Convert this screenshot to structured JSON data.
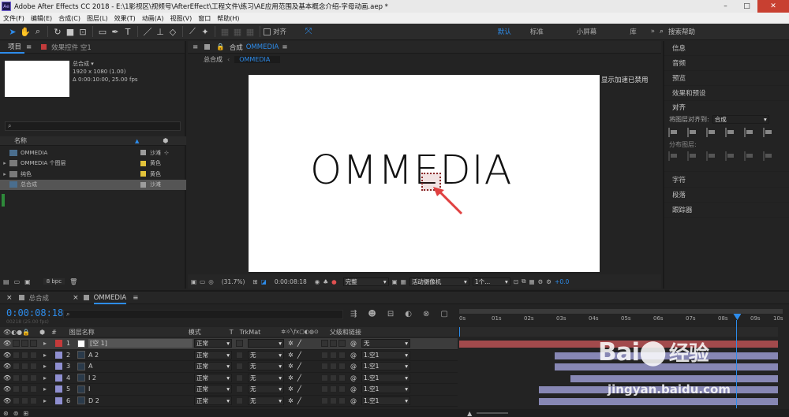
{
  "titlebar": {
    "app_icon": "Ae",
    "title": "Adobe After Effects CC 2018 - E:\\1影视区\\视频号\\AfterEffect\\工程文件\\练习\\AE应用范围及基本概念介绍-字母动画.aep *",
    "min": "–",
    "max": "□",
    "close": "✕"
  },
  "menu": [
    "文件(F)",
    "编辑(E)",
    "合成(C)",
    "图层(L)",
    "效果(T)",
    "动画(A)",
    "视图(V)",
    "窗口",
    "帮助(H)"
  ],
  "toolbar": {
    "snap_label": "对齐",
    "workspaces": [
      "默认",
      "标准",
      "小屏幕",
      "库"
    ],
    "more": "»",
    "search_placeholder": "搜索帮助"
  },
  "project": {
    "tab_project": "项目",
    "tab_effects": "效果控件 空1",
    "thumb_name": "总合成 ▾",
    "thumb_res": "1920 x 1080 (1.00)",
    "thumb_dur": "Δ 0:00:10:00, 25.00 fps",
    "col_name": "名称",
    "col_label": "标签",
    "items": [
      {
        "name": "OMMEDIA",
        "tag": "沙滩",
        "color": "#9c9c9c",
        "type": "comp"
      },
      {
        "name": "OMMEDIA 个图层",
        "tag": "黄色",
        "color": "#e2c23a",
        "type": "folder"
      },
      {
        "name": "纯色",
        "tag": "黄色",
        "color": "#e2c23a",
        "type": "folder"
      },
      {
        "name": "总合成",
        "tag": "沙滩",
        "color": "#9c9c9c",
        "type": "comp",
        "selected": true
      }
    ],
    "bpc": "8 bpc"
  },
  "composition": {
    "tab": "合成",
    "comp_link": "OMMEDIA",
    "breadcrumb_root": "总合成",
    "breadcrumb_child": "OMMEDIA",
    "canvas_text": "OMMEDIA",
    "gpu_note": "显示加速已禁用",
    "zoom": "(31.7%)",
    "timecode": "0:00:08:18",
    "resolution": "完整",
    "camera": "活动摄像机",
    "views": "1个...",
    "exposure": "+0.0"
  },
  "right_panel": {
    "items_top": [
      "信息",
      "音频",
      "预览",
      "效果和预设"
    ],
    "align_title": "对齐",
    "align_to_label": "将图层对齐到:",
    "align_to_value": "合成",
    "distribute_label": "分布图层:",
    "items_bottom": [
      "字符",
      "段落",
      "跟踪器"
    ]
  },
  "timeline": {
    "tab1": "总合成",
    "tab2": "OMMEDIA",
    "timecode": "0:00:08:18",
    "frames": "00218 (25.00 fps)",
    "col_layer": "图层名称",
    "col_mode": "模式",
    "col_t": "T",
    "col_trkmat": "TrkMat",
    "col_parent": "父级和链接",
    "ruler": [
      "0s",
      "01s",
      "02s",
      "03s",
      "04s",
      "05s",
      "06s",
      "07s",
      "08s",
      "09s",
      "10s"
    ],
    "playhead_frac": 0.87,
    "layers": [
      {
        "num": "1",
        "name": "[空 1]",
        "mode": "正常",
        "trk": "",
        "parent": "无",
        "color": "#c43a3a",
        "bar_start": 0.0,
        "bar_end": 1.0,
        "bar_color": "#a24a4c",
        "selected": true
      },
      {
        "num": "2",
        "name": "A 2",
        "mode": "正常",
        "trk": "无",
        "parent": "1.空1",
        "color": "#8f8fd0",
        "bar_start": 0.3,
        "bar_end": 1.0,
        "bar_color": "#8787b4"
      },
      {
        "num": "3",
        "name": "A",
        "mode": "正常",
        "trk": "无",
        "parent": "1.空1",
        "color": "#8f8fd0",
        "bar_start": 0.3,
        "bar_end": 1.0,
        "bar_color": "#8787b4"
      },
      {
        "num": "4",
        "name": "I 2",
        "mode": "正常",
        "trk": "无",
        "parent": "1.空1",
        "color": "#8f8fd0",
        "bar_start": 0.35,
        "bar_end": 1.0,
        "bar_color": "#8787b4"
      },
      {
        "num": "5",
        "name": "I",
        "mode": "正常",
        "trk": "无",
        "parent": "1.空1",
        "color": "#8f8fd0",
        "bar_start": 0.25,
        "bar_end": 1.0,
        "bar_color": "#8787b4"
      },
      {
        "num": "6",
        "name": "D 2",
        "mode": "正常",
        "trk": "无",
        "parent": "1.空1",
        "color": "#8f8fd0",
        "bar_start": 0.25,
        "bar_end": 1.0,
        "bar_color": "#8787b4"
      }
    ]
  },
  "watermark": {
    "brand": "Bai",
    "brand2": "经验",
    "url": "jingyan.baidu.com"
  }
}
